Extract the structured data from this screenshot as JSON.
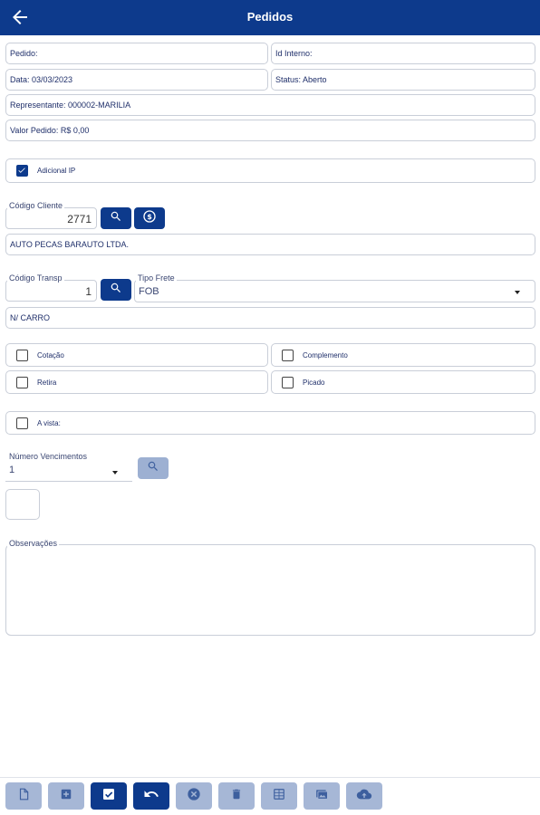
{
  "header": {
    "title": "Pedidos"
  },
  "info": {
    "pedido": "Pedido:",
    "id_interno": "Id Interno:",
    "data": "Data: 03/03/2023",
    "status": "Status: Aberto",
    "representante": "Representante: 000002-MARILIA",
    "valor_pedido": "Valor Pedido: R$ 0,00"
  },
  "adicional": {
    "label": "Adicional IP",
    "checked": true
  },
  "cliente": {
    "label": "Código Cliente",
    "value": "2771",
    "name": "AUTO PECAS BARAUTO LTDA."
  },
  "transporte": {
    "label": "Código Transp",
    "value": "1",
    "frete_label": "Tipo Frete",
    "frete_value": "FOB",
    "name": "N/ CARRO"
  },
  "options": {
    "cotacao": "Cotação",
    "complemento": "Complemento",
    "retira": "Retira",
    "picado": "Picado",
    "a_vista": "A vista:"
  },
  "vencimentos": {
    "label": "Número Vencimentos",
    "value": "1"
  },
  "observacoes": {
    "label": "Observações"
  },
  "colors": {
    "primary": "#0d3a8c",
    "disabled": "#a6b7d6",
    "border": "#c9ced8"
  },
  "toolbar": {
    "icons": [
      "document-icon",
      "add-icon",
      "check-icon",
      "undo-icon",
      "cancel-icon",
      "trash-icon",
      "table-icon",
      "image-icon",
      "cloud-upload-icon"
    ]
  }
}
